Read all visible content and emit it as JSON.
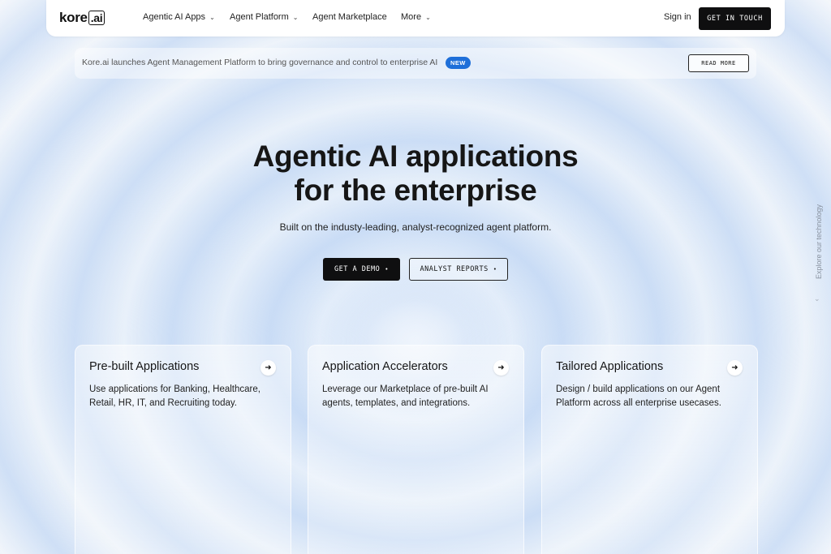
{
  "nav": {
    "logo_main": "kore",
    "logo_ai": ".ai",
    "items": [
      {
        "label": "Agentic AI Apps",
        "has_menu": true
      },
      {
        "label": "Agent Platform",
        "has_menu": true
      },
      {
        "label": "Agent Marketplace",
        "has_menu": false
      },
      {
        "label": "More",
        "has_menu": true
      }
    ],
    "signin": "Sign in",
    "cta": "GET IN TOUCH"
  },
  "banner": {
    "text": "Kore.ai launches Agent Management Platform to bring governance and control to enterprise AI",
    "badge": "NEW",
    "button": "READ MORE"
  },
  "hero": {
    "title_line1": "Agentic AI applications",
    "title_line2": "for the enterprise",
    "subtitle": "Built on the industy-leading, analyst-recognized agent platform.",
    "demo_button": "GET A DEMO",
    "reports_button": "ANALYST REPORTS",
    "button_dot": "•"
  },
  "side": {
    "label": "Explore our technology",
    "icon": "chevron-down-icon"
  },
  "cards": [
    {
      "title": "Pre-built Applications",
      "desc": "Use applications for Banking, Healthcare, Retail, HR, IT, and Recruiting today."
    },
    {
      "title": "Application Accelerators",
      "desc": "Leverage our Marketplace of pre-built AI agents, templates, and integrations."
    },
    {
      "title": "Tailored Applications",
      "desc": "Design / build applications on our Agent Platform across all enterprise usecases."
    }
  ],
  "colors": {
    "accent": "#1e6fd9",
    "dark_button": "#0f0f10",
    "background": "#e6eef9"
  }
}
